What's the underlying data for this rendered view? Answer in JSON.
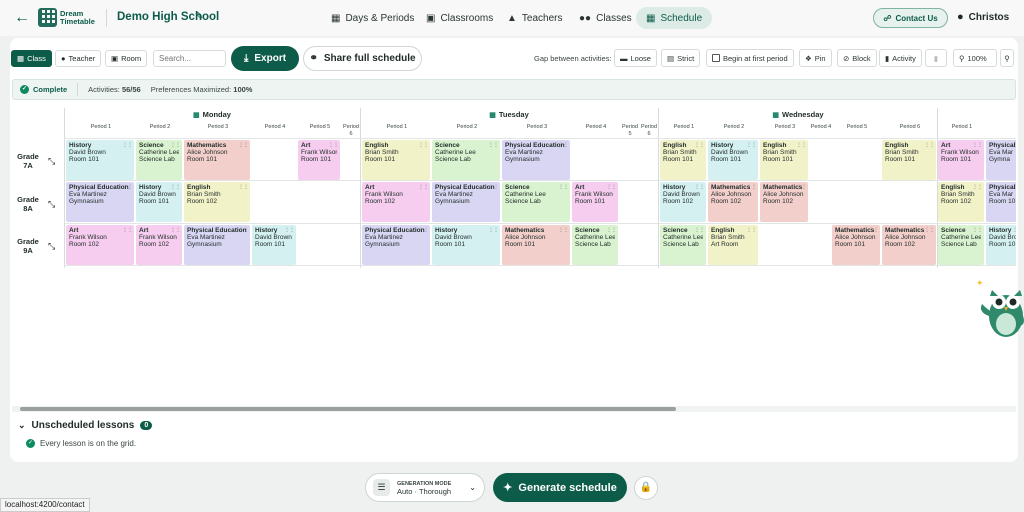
{
  "nav": {
    "school": "Demo High School",
    "logo_line1": "Dream",
    "logo_line2": "Timetable",
    "tabs": [
      {
        "label": "Days & Periods",
        "icon": "calendar-icon"
      },
      {
        "label": "Classrooms",
        "icon": "building-icon"
      },
      {
        "label": "Teachers",
        "icon": "graduation-cap-icon"
      },
      {
        "label": "Classes",
        "icon": "users-icon"
      },
      {
        "label": "Schedule",
        "icon": "calendar-icon",
        "active": true
      }
    ],
    "contact": "Contact Us",
    "user": "Christos"
  },
  "toolbar": {
    "view_class": "Class",
    "view_teacher": "Teacher",
    "view_room": "Room",
    "search_placeholder": "Search...",
    "export": "Export",
    "share": "Share full schedule",
    "gap_label": "Gap between activities:",
    "loose": "Loose",
    "strict": "Strict",
    "begin_first": "Begin at first period",
    "pin": "Pin",
    "block": "Block",
    "activity": "Activity",
    "zoom": "100%"
  },
  "status": {
    "complete": "Complete",
    "activities_label": "Activities:",
    "activities_value": "56/56",
    "prefs_label": "Preferences Maximized:",
    "prefs_value": "100%"
  },
  "days": [
    "Monday",
    "Tuesday",
    "Wednesday"
  ],
  "periods": {
    "monday": [
      "Period 1",
      "Period 2",
      "Period 3",
      "Period 4",
      "Period 5",
      "Period 6"
    ],
    "tuesday": [
      "Period 1",
      "Period 2",
      "Period 3",
      "Period 4",
      "Period 5",
      "Period 6"
    ],
    "wednesday": [
      "Period 1",
      "Period 2",
      "Period 3",
      "Period 4",
      "Period 5",
      "Period 6",
      "Period 1"
    ]
  },
  "rows": [
    {
      "name": "Grade 7A"
    },
    {
      "name": "Grade 8A"
    },
    {
      "name": "Grade 9A"
    }
  ],
  "colors": {
    "history": "#d4f0f1",
    "science": "#d9f2cf",
    "mathematics": "#f3cfcc",
    "art": "#f6cdef",
    "english": "#f2f2c9",
    "pe": "#d8d6f2",
    "accent": "#0d5c4a"
  },
  "lessons": [
    {
      "row": 0,
      "day": 0,
      "col": 0,
      "subject": "History",
      "teacher": "David Brown",
      "room": "Room 101",
      "kind": "history"
    },
    {
      "row": 0,
      "day": 0,
      "col": 1,
      "subject": "Science",
      "teacher": "Catherine Lee",
      "room": "Science Lab",
      "kind": "science"
    },
    {
      "row": 0,
      "day": 0,
      "col": 2,
      "subject": "Mathematics",
      "teacher": "Alice Johnson",
      "room": "Room 101",
      "kind": "mathematics"
    },
    {
      "row": 0,
      "day": 0,
      "col": 4,
      "subject": "Art",
      "teacher": "Frank Wilson",
      "room": "Room 101",
      "kind": "art"
    },
    {
      "row": 0,
      "day": 1,
      "col": 0,
      "subject": "English",
      "teacher": "Brian Smith",
      "room": "Room 101",
      "kind": "english"
    },
    {
      "row": 0,
      "day": 1,
      "col": 1,
      "subject": "Science",
      "teacher": "Catherine Lee",
      "room": "Science Lab",
      "kind": "science"
    },
    {
      "row": 0,
      "day": 1,
      "col": 2,
      "subject": "Physical Education",
      "teacher": "Eva Martinez",
      "room": "Gymnasium",
      "kind": "pe"
    },
    {
      "row": 0,
      "day": 2,
      "col": 0,
      "subject": "English",
      "teacher": "Brian Smith",
      "room": "Room 101",
      "kind": "english"
    },
    {
      "row": 0,
      "day": 2,
      "col": 1,
      "subject": "History",
      "teacher": "David Brown",
      "room": "Room 101",
      "kind": "history"
    },
    {
      "row": 0,
      "day": 2,
      "col": 2,
      "subject": "English",
      "teacher": "Brian Smith",
      "room": "Room 101",
      "kind": "english"
    },
    {
      "row": 0,
      "day": 2,
      "col": 5,
      "subject": "English",
      "teacher": "Brian Smith",
      "room": "Room 101",
      "kind": "english"
    },
    {
      "row": 0,
      "day": 2,
      "col": 6,
      "subject": "Art",
      "teacher": "Frank Wilson",
      "room": "Room 101",
      "kind": "art"
    },
    {
      "row": 0,
      "day": 2,
      "col": 7,
      "subject": "Physical",
      "teacher": "Eva Mar",
      "room": "Gymna",
      "kind": "pe"
    },
    {
      "row": 1,
      "day": 0,
      "col": 0,
      "subject": "Physical Education",
      "teacher": "Eva Martinez",
      "room": "Gymnasium",
      "kind": "pe"
    },
    {
      "row": 1,
      "day": 0,
      "col": 1,
      "subject": "History",
      "teacher": "David Brown",
      "room": "Room 101",
      "kind": "history"
    },
    {
      "row": 1,
      "day": 0,
      "col": 2,
      "subject": "English",
      "teacher": "Brian Smith",
      "room": "Room 102",
      "kind": "english"
    },
    {
      "row": 1,
      "day": 1,
      "col": 0,
      "subject": "Art",
      "teacher": "Frank Wilson",
      "room": "Room 102",
      "kind": "art"
    },
    {
      "row": 1,
      "day": 1,
      "col": 1,
      "subject": "Physical Education",
      "teacher": "Eva Martinez",
      "room": "Gymnasium",
      "kind": "pe"
    },
    {
      "row": 1,
      "day": 1,
      "col": 2,
      "subject": "Science",
      "teacher": "Catherine Lee",
      "room": "Science Lab",
      "kind": "science"
    },
    {
      "row": 1,
      "day": 1,
      "col": 3,
      "subject": "Art",
      "teacher": "Frank Wilson",
      "room": "Room 101",
      "kind": "art"
    },
    {
      "row": 1,
      "day": 2,
      "col": 0,
      "subject": "History",
      "teacher": "David Brown",
      "room": "Room 102",
      "kind": "history"
    },
    {
      "row": 1,
      "day": 2,
      "col": 1,
      "subject": "Mathematics",
      "teacher": "Alice Johnson",
      "room": "Room 102",
      "kind": "mathematics"
    },
    {
      "row": 1,
      "day": 2,
      "col": 2,
      "subject": "Mathematics",
      "teacher": "Alice Johnson",
      "room": "Room 102",
      "kind": "mathematics"
    },
    {
      "row": 1,
      "day": 2,
      "col": 6,
      "subject": "English",
      "teacher": "Brian Smith",
      "room": "Room 102",
      "kind": "english"
    },
    {
      "row": 1,
      "day": 2,
      "col": 7,
      "subject": "Physical",
      "teacher": "Eva Mar",
      "room": "Room 10",
      "kind": "pe"
    },
    {
      "row": 2,
      "day": 0,
      "col": 0,
      "subject": "Art",
      "teacher": "Frank Wilson",
      "room": "Room 102",
      "kind": "art"
    },
    {
      "row": 2,
      "day": 0,
      "col": 1,
      "subject": "Art",
      "teacher": "Frank Wilson",
      "room": "Room 102",
      "kind": "art"
    },
    {
      "row": 2,
      "day": 0,
      "col": 2,
      "subject": "Physical Education",
      "teacher": "Eva Martinez",
      "room": "Gymnasium",
      "kind": "pe"
    },
    {
      "row": 2,
      "day": 0,
      "col": 3,
      "subject": "History",
      "teacher": "David Brown",
      "room": "Room 101",
      "kind": "history"
    },
    {
      "row": 2,
      "day": 1,
      "col": 0,
      "subject": "Physical Education",
      "teacher": "Eva Martinez",
      "room": "Gymnasium",
      "kind": "pe"
    },
    {
      "row": 2,
      "day": 1,
      "col": 1,
      "subject": "History",
      "teacher": "David Brown",
      "room": "Room 101",
      "kind": "history"
    },
    {
      "row": 2,
      "day": 1,
      "col": 2,
      "subject": "Mathematics",
      "teacher": "Alice Johnson",
      "room": "Room 101",
      "kind": "mathematics"
    },
    {
      "row": 2,
      "day": 1,
      "col": 3,
      "subject": "Science",
      "teacher": "Catherine Lee",
      "room": "Science Lab",
      "kind": "science"
    },
    {
      "row": 2,
      "day": 2,
      "col": 0,
      "subject": "Science",
      "teacher": "Catherine Lee",
      "room": "Science Lab",
      "kind": "science"
    },
    {
      "row": 2,
      "day": 2,
      "col": 1,
      "subject": "English",
      "teacher": "Brian Smith",
      "room": "Art Room",
      "kind": "english"
    },
    {
      "row": 2,
      "day": 2,
      "col": 4,
      "subject": "Mathematics",
      "teacher": "Alice Johnson",
      "room": "Room 101",
      "kind": "mathematics"
    },
    {
      "row": 2,
      "day": 2,
      "col": 5,
      "subject": "Mathematics",
      "teacher": "Alice Johnson",
      "room": "Room 102",
      "kind": "mathematics"
    },
    {
      "row": 2,
      "day": 2,
      "col": 6,
      "subject": "Science",
      "teacher": "Catherine Lee",
      "room": "Science Lab",
      "kind": "science"
    },
    {
      "row": 2,
      "day": 2,
      "col": 7,
      "subject": "History",
      "teacher": "David Bro",
      "room": "Room 10",
      "kind": "history"
    }
  ],
  "unscheduled": {
    "title": "Unscheduled lessons",
    "count": "0",
    "message": "Every lesson is on the grid."
  },
  "bottom": {
    "gen_mode_label": "GENERATION MODE",
    "gen_mode_value": "Auto · Thorough",
    "generate": "Generate schedule"
  },
  "statusbar": "localhost:4200/contact"
}
